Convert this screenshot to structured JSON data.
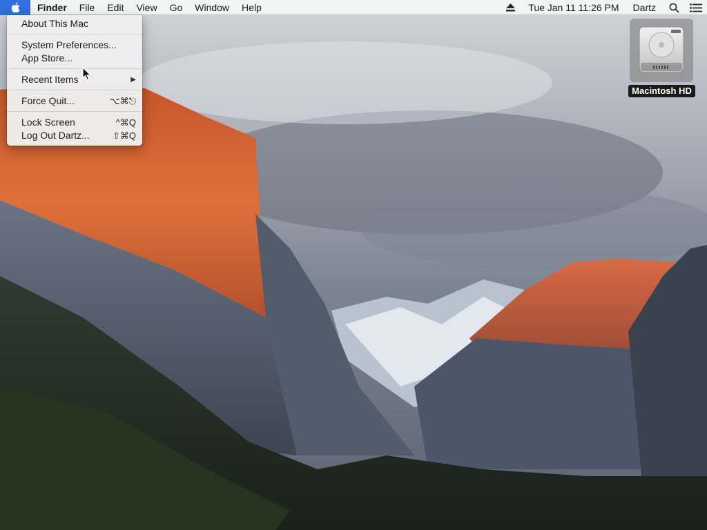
{
  "menubar": {
    "app_name": "Finder",
    "menus": [
      "File",
      "Edit",
      "View",
      "Go",
      "Window",
      "Help"
    ],
    "clock": "Tue Jan 11  11:26 PM",
    "user": "Dartz",
    "icons": [
      "apple-icon",
      "eject-icon",
      "search-icon",
      "notification-center-icon"
    ],
    "accent_color": "#2f6fe0"
  },
  "apple_menu": {
    "about": "About This Mac",
    "system_preferences": "System Preferences...",
    "app_store": "App Store...",
    "recent_items": "Recent Items",
    "force_quit": "Force Quit...",
    "force_quit_shortcut": "⌥⌘⎋",
    "lock_screen": "Lock Screen",
    "lock_screen_shortcut": "^⌘Q",
    "log_out": "Log Out Dartz...",
    "log_out_shortcut": "⇧⌘Q"
  },
  "desktop": {
    "drive_label": "Macintosh HD",
    "drive_icon": "hard-drive-icon"
  }
}
